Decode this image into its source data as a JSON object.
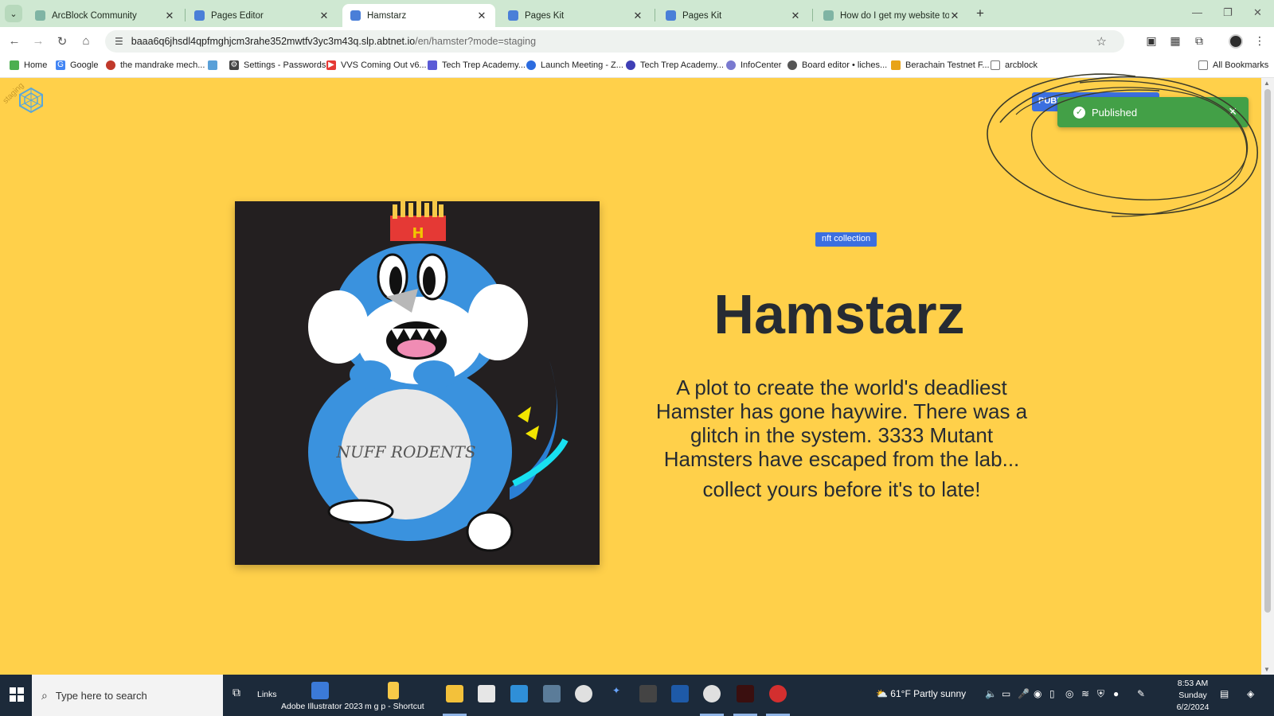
{
  "browser": {
    "tabs": [
      {
        "title": "ArcBlock Community",
        "active": false,
        "favicon_color": "#7fb4a4"
      },
      {
        "title": "Pages Editor",
        "active": false,
        "favicon_color": "#4a7fd8"
      },
      {
        "title": "Hamstarz",
        "active": true,
        "favicon_color": "#4a7fd8"
      },
      {
        "title": "Pages Kit",
        "active": false,
        "favicon_color": "#4a7fd8"
      },
      {
        "title": "Pages Kit",
        "active": false,
        "favicon_color": "#4a7fd8"
      },
      {
        "title": "How do I get my website to pu",
        "active": false,
        "favicon_color": "#7fb4a4"
      }
    ],
    "url_host": "baaa6q6jhsdl4qpfmghjcm3rahe352mwtfv3yc3m43q.slp.abtnet.io",
    "url_path": "/en/hamster?mode=staging",
    "bookmarks": [
      {
        "label": "Home",
        "color": "#4caf50"
      },
      {
        "label": "Google",
        "color": "#4285f4"
      },
      {
        "label": "the mandrake mech...",
        "color": "#c0392b"
      },
      {
        "label": "",
        "color": "#5aa0d8"
      },
      {
        "label": "Settings - Passwords",
        "color": "#444444"
      },
      {
        "label": "VVS Coming Out v6...",
        "color": "#e53935"
      },
      {
        "label": "Tech Trep Academy...",
        "color": "#5b5bd6"
      },
      {
        "label": "Launch Meeting - Z...",
        "color": "#2d6cdf"
      },
      {
        "label": "Tech Trep Academy...",
        "color": "#3f3fb5"
      },
      {
        "label": "InfoCenter",
        "color": "#7a7ad0"
      },
      {
        "label": "Board editor • liches...",
        "color": "#555555"
      },
      {
        "label": "Berachain Testnet F...",
        "color": "#e8a317"
      },
      {
        "label": "arcblock",
        "color": "#777777"
      }
    ],
    "all_bookmarks": "All Bookmarks"
  },
  "page": {
    "staging_label": "staging",
    "publish_button": "PUBL",
    "toast": "Published",
    "tag": "nft collection",
    "title": "Hamstarz",
    "description": "A plot to create the world's deadliest Hamster has gone haywire. There was a glitch in the system. 3333 Mutant Hamsters have escaped from the lab...",
    "cta": "collect yours before it's to late!",
    "art_text": "NUFF RODENTS",
    "colors": {
      "background": "#ffd04a",
      "accent": "#3b6fe0",
      "toast": "#43a047",
      "frame": "#231f20"
    }
  },
  "taskbar": {
    "search_placeholder": "Type here to search",
    "links": "Links",
    "pinned_illustrator": "Adobe Illustrator 2023",
    "pinned_shortcut": "m g p - Shortcut",
    "weather": "61°F  Partly sunny",
    "time": "8:53 AM",
    "day": "Sunday",
    "date": "6/2/2024"
  }
}
